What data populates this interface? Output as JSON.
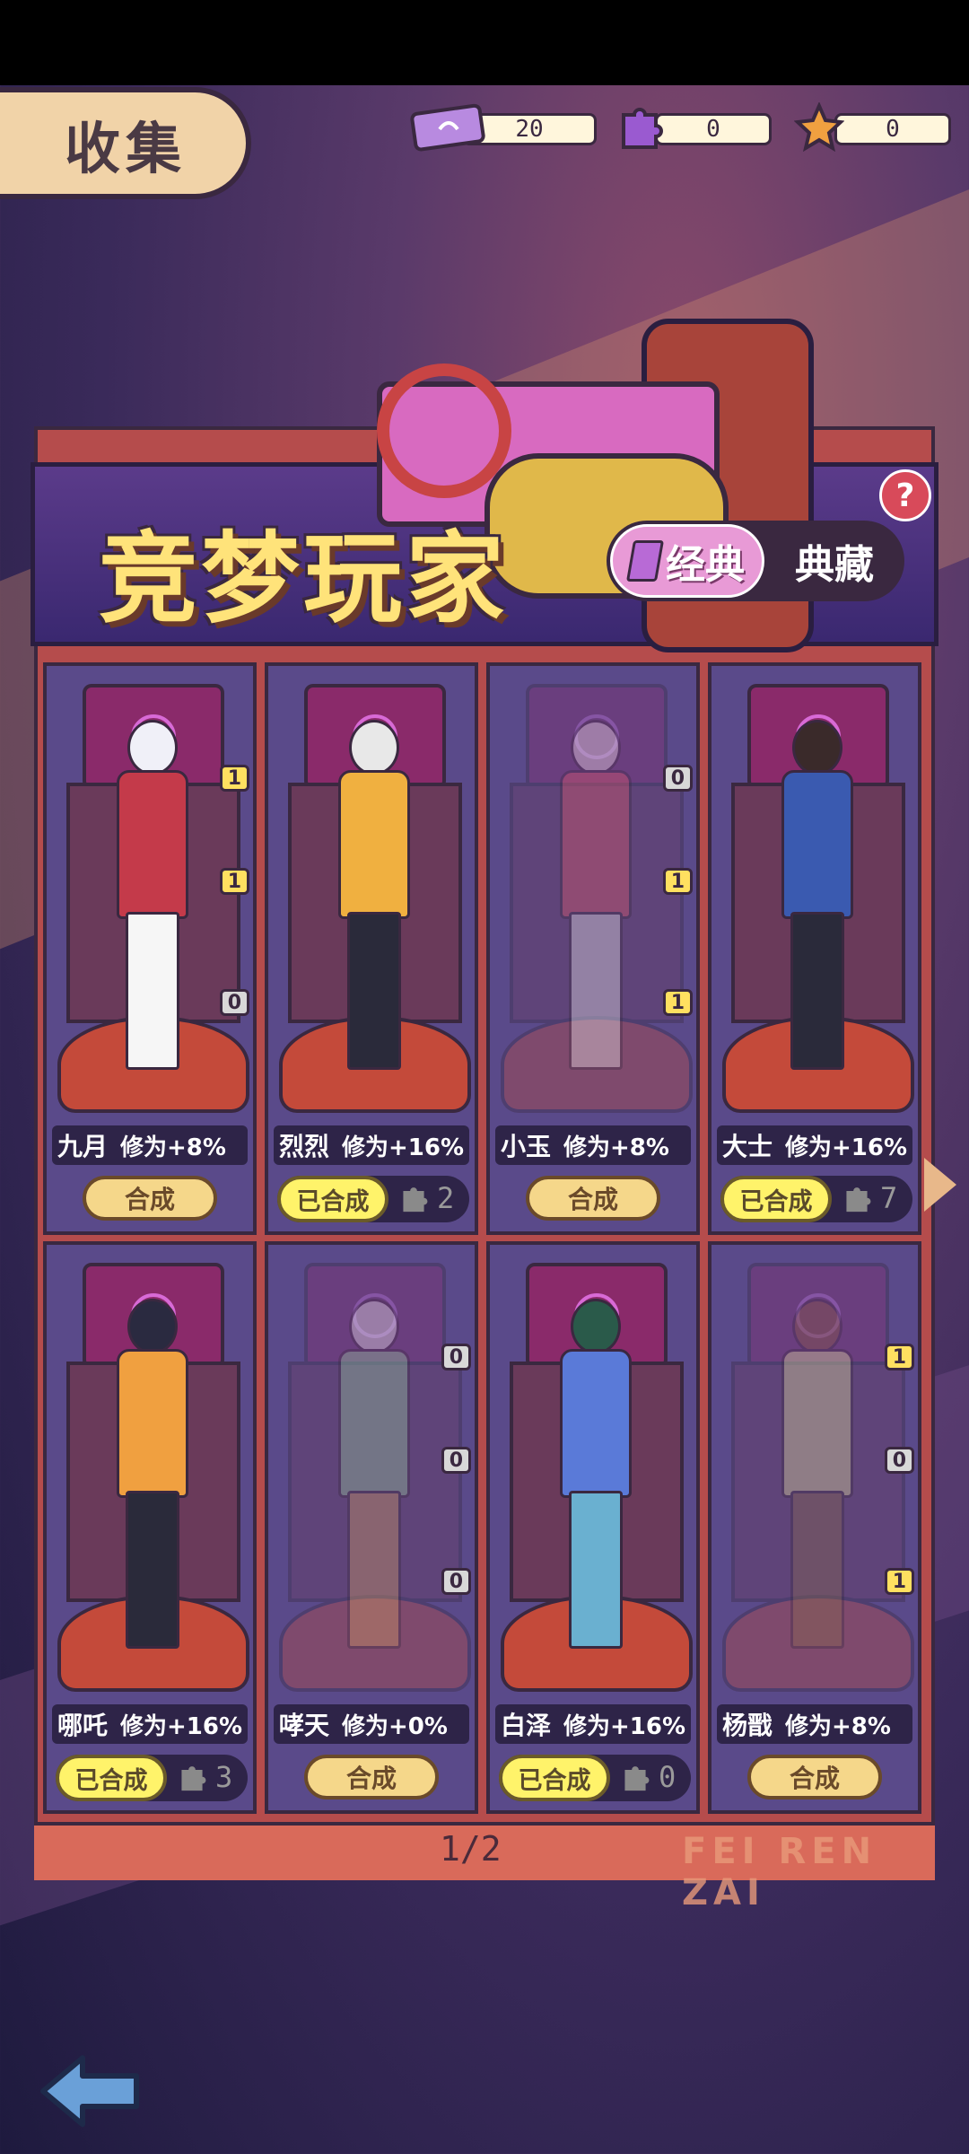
{
  "header": {
    "collect_label": "收集",
    "title": "竞梦玩家",
    "tabs": [
      {
        "label": "经典",
        "active": true
      },
      {
        "label": "典藏",
        "active": false
      }
    ],
    "help_label": "?"
  },
  "currencies": [
    {
      "icon": "ticket-icon",
      "value": "20",
      "color": "#b88ae0"
    },
    {
      "icon": "puzzle-icon",
      "value": "0",
      "color": "#9a5ad0"
    },
    {
      "icon": "star-icon",
      "value": "0",
      "color": "#f0a040"
    }
  ],
  "cards": [
    {
      "name": "九月",
      "bonus": "修为+8%",
      "state": "synth",
      "button": "合成",
      "badges": [
        "1",
        "1",
        "0"
      ],
      "faded": false,
      "piece_count": null
    },
    {
      "name": "烈烈",
      "bonus": "修为+16%",
      "state": "done",
      "button": "已合成",
      "badges": [],
      "faded": false,
      "piece_count": "2"
    },
    {
      "name": "小玉",
      "bonus": "修为+8%",
      "state": "synth",
      "button": "合成",
      "badges": [
        "0",
        "1",
        "1"
      ],
      "faded": true,
      "piece_count": null
    },
    {
      "name": "大士",
      "bonus": "修为+16%",
      "state": "done",
      "button": "已合成",
      "badges": [],
      "faded": false,
      "piece_count": "7"
    },
    {
      "name": "哪吒",
      "bonus": "修为+16%",
      "state": "done",
      "button": "已合成",
      "badges": [],
      "faded": false,
      "piece_count": "3"
    },
    {
      "name": "哮天",
      "bonus": "修为+0%",
      "state": "synth",
      "button": "合成",
      "badges": [
        "0",
        "0",
        "0"
      ],
      "faded": true,
      "piece_count": null
    },
    {
      "name": "白泽",
      "bonus": "修为+16%",
      "state": "done",
      "button": "已合成",
      "badges": [],
      "faded": false,
      "piece_count": "0"
    },
    {
      "name": "杨戬",
      "bonus": "修为+8%",
      "state": "synth",
      "button": "合成",
      "badges": [
        "1",
        "0",
        "1"
      ],
      "faded": true,
      "piece_count": null
    }
  ],
  "pager": {
    "label": "1/2",
    "watermark": "FEI REN ZAI"
  },
  "colors": {
    "accent": "#ffe37a",
    "panel": "#b54c4c",
    "header": "#4a2f7a"
  }
}
